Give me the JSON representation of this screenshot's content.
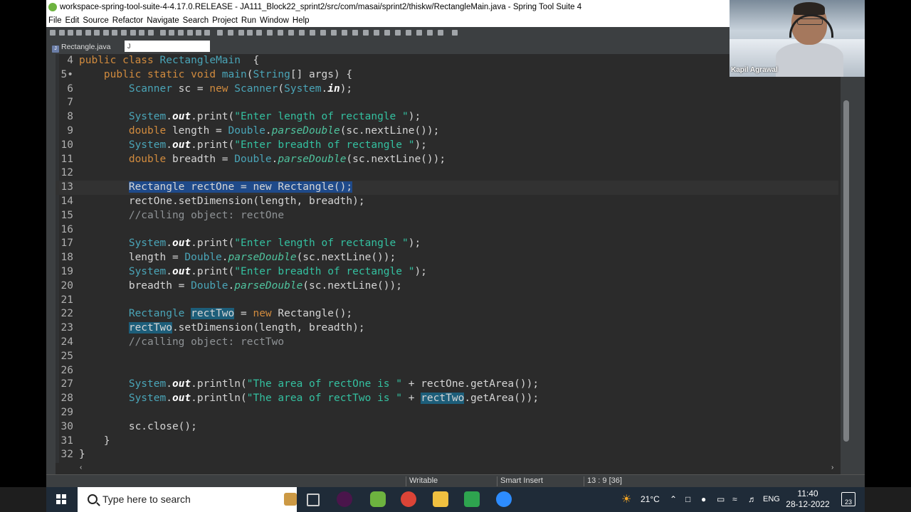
{
  "window": {
    "title": "workspace-spring-tool-suite-4-4.17.0.RELEASE - JA111_Block22_sprint2/src/com/masai/sprint2/thiskw/RectangleMain.java - Spring Tool Suite 4"
  },
  "menu": [
    "File",
    "Edit",
    "Source",
    "Refactor",
    "Navigate",
    "Search",
    "Project",
    "Run",
    "Window",
    "Help"
  ],
  "tabs": {
    "first": "Rectangle.java",
    "second": "J"
  },
  "code_lines": [
    {
      "n": "4",
      "cur": false,
      "segs": [
        [
          "kw",
          "public "
        ],
        [
          "kw",
          "class "
        ],
        [
          "ty",
          "RectangleMain"
        ],
        [
          "",
          "  {"
        ]
      ]
    },
    {
      "n": "5•",
      "cur": false,
      "segs": [
        [
          "",
          "    "
        ],
        [
          "kw",
          "public "
        ],
        [
          "kw",
          "static "
        ],
        [
          "kw",
          "void "
        ],
        [
          "ty",
          "main"
        ],
        [
          "",
          "("
        ],
        [
          "ty",
          "String"
        ],
        [
          "",
          "[] "
        ],
        [
          "",
          "args"
        ],
        [
          "",
          ") {"
        ]
      ]
    },
    {
      "n": "6",
      "cur": false,
      "segs": [
        [
          "",
          "        "
        ],
        [
          "ty",
          "Scanner"
        ],
        [
          "",
          " sc = "
        ],
        [
          "kw",
          "new "
        ],
        [
          "ty",
          "Scanner"
        ],
        [
          "",
          "("
        ],
        [
          "ty",
          "System"
        ],
        [
          "",
          "."
        ],
        [
          "fld",
          "in"
        ],
        [
          "",
          ");"
        ]
      ]
    },
    {
      "n": "7",
      "cur": false,
      "segs": []
    },
    {
      "n": "8",
      "cur": false,
      "segs": [
        [
          "",
          "        "
        ],
        [
          "ty",
          "System"
        ],
        [
          "",
          "."
        ],
        [
          "fld",
          "out"
        ],
        [
          "",
          ".print("
        ],
        [
          "str",
          "\"Enter length of rectangle \""
        ],
        [
          "",
          ");"
        ]
      ]
    },
    {
      "n": "9",
      "cur": false,
      "segs": [
        [
          "",
          "        "
        ],
        [
          "kw",
          "double "
        ],
        [
          "",
          "length = "
        ],
        [
          "ty",
          "Double"
        ],
        [
          "",
          "."
        ],
        [
          "it",
          "parseDouble"
        ],
        [
          "",
          "(sc.nextLine());"
        ]
      ]
    },
    {
      "n": "10",
      "cur": false,
      "segs": [
        [
          "",
          "        "
        ],
        [
          "ty",
          "System"
        ],
        [
          "",
          "."
        ],
        [
          "fld",
          "out"
        ],
        [
          "",
          ".print("
        ],
        [
          "str",
          "\"Enter breadth of rectangle \""
        ],
        [
          "",
          ");"
        ]
      ]
    },
    {
      "n": "11",
      "cur": false,
      "segs": [
        [
          "",
          "        "
        ],
        [
          "kw",
          "double "
        ],
        [
          "",
          "breadth = "
        ],
        [
          "ty",
          "Double"
        ],
        [
          "",
          "."
        ],
        [
          "it",
          "parseDouble"
        ],
        [
          "",
          "(sc.nextLine());"
        ]
      ]
    },
    {
      "n": "12",
      "cur": false,
      "segs": []
    },
    {
      "n": "13",
      "cur": true,
      "segs": [
        [
          "",
          "        "
        ],
        [
          "sel",
          "Rectangle rectOne = new Rectangle();"
        ]
      ]
    },
    {
      "n": "14",
      "cur": false,
      "segs": [
        [
          "",
          "        rectOne.setDimension(length, breadth);"
        ]
      ]
    },
    {
      "n": "15",
      "cur": false,
      "segs": [
        [
          "",
          "        "
        ],
        [
          "cm",
          "//calling object: rectOne"
        ]
      ]
    },
    {
      "n": "16",
      "cur": false,
      "segs": []
    },
    {
      "n": "17",
      "cur": false,
      "segs": [
        [
          "",
          "        "
        ],
        [
          "ty",
          "System"
        ],
        [
          "",
          "."
        ],
        [
          "fld",
          "out"
        ],
        [
          "",
          ".print("
        ],
        [
          "str",
          "\"Enter length of rectangle \""
        ],
        [
          "",
          ");"
        ]
      ]
    },
    {
      "n": "18",
      "cur": false,
      "segs": [
        [
          "",
          "        length = "
        ],
        [
          "ty",
          "Double"
        ],
        [
          "",
          "."
        ],
        [
          "it",
          "parseDouble"
        ],
        [
          "",
          "(sc.nextLine());"
        ]
      ]
    },
    {
      "n": "19",
      "cur": false,
      "segs": [
        [
          "",
          "        "
        ],
        [
          "ty",
          "System"
        ],
        [
          "",
          "."
        ],
        [
          "fld",
          "out"
        ],
        [
          "",
          ".print("
        ],
        [
          "str",
          "\"Enter breadth of rectangle \""
        ],
        [
          "",
          ");"
        ]
      ]
    },
    {
      "n": "20",
      "cur": false,
      "segs": [
        [
          "",
          "        breadth = "
        ],
        [
          "ty",
          "Double"
        ],
        [
          "",
          "."
        ],
        [
          "it",
          "parseDouble"
        ],
        [
          "",
          "(sc.nextLine());"
        ]
      ]
    },
    {
      "n": "21",
      "cur": false,
      "segs": []
    },
    {
      "n": "22",
      "cur": false,
      "segs": [
        [
          "",
          "        "
        ],
        [
          "ty",
          "Rectangle "
        ],
        [
          "occ",
          "rectTwo"
        ],
        [
          "",
          " = "
        ],
        [
          "kw",
          "new "
        ],
        [
          "",
          "Rectangle();"
        ]
      ]
    },
    {
      "n": "23",
      "cur": false,
      "segs": [
        [
          "",
          "        "
        ],
        [
          "occ",
          "rectTwo"
        ],
        [
          "",
          ".setDimension(length, breadth);"
        ]
      ]
    },
    {
      "n": "24",
      "cur": false,
      "segs": [
        [
          "",
          "        "
        ],
        [
          "cm",
          "//calling object: rectTwo"
        ]
      ]
    },
    {
      "n": "25",
      "cur": false,
      "segs": []
    },
    {
      "n": "26",
      "cur": false,
      "segs": []
    },
    {
      "n": "27",
      "cur": false,
      "segs": [
        [
          "",
          "        "
        ],
        [
          "ty",
          "System"
        ],
        [
          "",
          "."
        ],
        [
          "fld",
          "out"
        ],
        [
          "",
          ".println("
        ],
        [
          "str",
          "\"The area of rectOne is \""
        ],
        [
          "",
          " + rectOne.getArea());"
        ]
      ]
    },
    {
      "n": "28",
      "cur": false,
      "segs": [
        [
          "",
          "        "
        ],
        [
          "ty",
          "System"
        ],
        [
          "",
          "."
        ],
        [
          "fld",
          "out"
        ],
        [
          "",
          ".println("
        ],
        [
          "str",
          "\"The area of rectTwo is \""
        ],
        [
          "",
          " + "
        ],
        [
          "occ",
          "rectTwo"
        ],
        [
          "",
          ".getArea());"
        ]
      ]
    },
    {
      "n": "29",
      "cur": false,
      "segs": []
    },
    {
      "n": "30",
      "cur": false,
      "segs": [
        [
          "",
          "        sc.close();"
        ]
      ]
    },
    {
      "n": "31",
      "cur": false,
      "segs": [
        [
          "",
          "    }"
        ]
      ]
    },
    {
      "n": "32",
      "cur": false,
      "segs": [
        [
          "",
          "}"
        ]
      ]
    }
  ],
  "status": {
    "writable": "Writable",
    "insert_mode": "Smart Insert",
    "position": "13 : 9 [36]"
  },
  "video": {
    "participant_name": "Kapil Agrawal"
  },
  "taskbar": {
    "search_placeholder": "Type here to search",
    "weather": "21°C",
    "language": "ENG",
    "time": "11:40",
    "date": "28-12-2022",
    "notification_count": "23"
  }
}
